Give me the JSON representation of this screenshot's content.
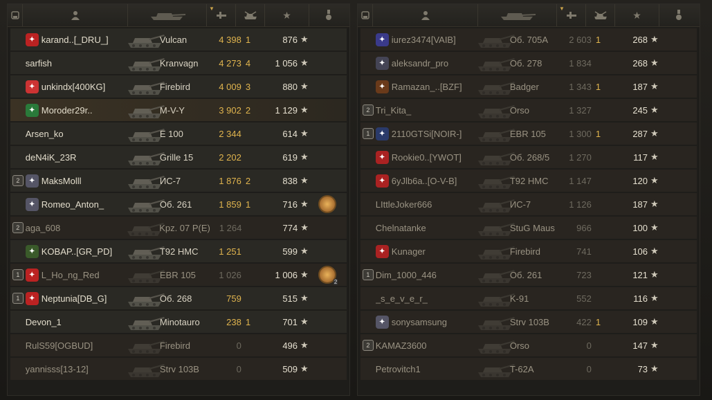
{
  "headers": {
    "platoon": "platoon",
    "player": "player",
    "tank": "tank",
    "damage": "damage",
    "kills": "kills",
    "xp": "xp",
    "achievements": "achievements"
  },
  "left_team": [
    {
      "name": "karand..[_DRU_]",
      "tank": "Vulcan",
      "damage": "4 398",
      "kills": "1",
      "xp": "876",
      "emblem": "#b22",
      "dead": false,
      "platoon": "",
      "medal": false
    },
    {
      "name": "sarfish",
      "tank": "Kranvagn",
      "damage": "4 273",
      "kills": "4",
      "xp": "1 056",
      "emblem": "",
      "dead": false,
      "platoon": "",
      "medal": false
    },
    {
      "name": "unkindx[400KG]",
      "tank": "Firebird",
      "damage": "4 009",
      "kills": "3",
      "xp": "880",
      "emblem": "#c33",
      "dead": false,
      "platoon": "",
      "medal": false
    },
    {
      "name": "Moroder29r..",
      "tank": "M-V-Y",
      "damage": "3 902",
      "kills": "2",
      "xp": "1 129",
      "emblem": "#2a7a3a",
      "dead": false,
      "platoon": "",
      "medal": false,
      "highlight": true
    },
    {
      "name": "Arsen_ko",
      "tank": "E 100",
      "damage": "2 344",
      "kills": "",
      "xp": "614",
      "emblem": "",
      "dead": false,
      "platoon": "",
      "medal": false
    },
    {
      "name": "deN4iK_23R",
      "tank": "Grille 15",
      "damage": "2 202",
      "kills": "",
      "xp": "619",
      "emblem": "",
      "dead": false,
      "platoon": "",
      "medal": false
    },
    {
      "name": "MaksMolll",
      "tank": "ИС-7",
      "damage": "1 876",
      "kills": "2",
      "xp": "838",
      "emblem": "#556",
      "dead": false,
      "platoon": "2",
      "medal": false
    },
    {
      "name": "Romeo_Anton_",
      "tank": "Об. 261",
      "damage": "1 859",
      "kills": "1",
      "xp": "716",
      "emblem": "#556",
      "dead": false,
      "platoon": "",
      "medal": true,
      "medal_count": ""
    },
    {
      "name": "aga_608",
      "tank": "Kpz. 07 P(E)",
      "damage": "1 264",
      "kills": "",
      "xp": "774",
      "emblem": "",
      "dead": true,
      "platoon": "2",
      "medal": false
    },
    {
      "name": "KOBAP..[GR_PD]",
      "tank": "T92 HMC",
      "damage": "1 251",
      "kills": "",
      "xp": "599",
      "emblem": "#3a5a2a",
      "dead": false,
      "platoon": "",
      "medal": false
    },
    {
      "name": "L_Ho_ng_Red",
      "tank": "EBR 105",
      "damage": "1 026",
      "kills": "",
      "xp": "1 006",
      "emblem": "#b22",
      "dead": true,
      "platoon": "1",
      "medal": true,
      "medal_count": "2"
    },
    {
      "name": "Neptunia[DB_G]",
      "tank": "Об. 268",
      "damage": "759",
      "kills": "",
      "xp": "515",
      "emblem": "#b22",
      "dead": false,
      "platoon": "1",
      "medal": false
    },
    {
      "name": "Devon_1",
      "tank": "Minotauro",
      "damage": "238",
      "kills": "1",
      "xp": "701",
      "emblem": "",
      "dead": false,
      "platoon": "",
      "medal": false
    },
    {
      "name": "RulS59[OGBUD]",
      "tank": "Firebird",
      "damage": "0",
      "kills": "",
      "xp": "496",
      "emblem": "",
      "dead": true,
      "platoon": "",
      "medal": false
    },
    {
      "name": "yannisss[13-12]",
      "tank": "Strv 103B",
      "damage": "0",
      "kills": "",
      "xp": "509",
      "emblem": "",
      "dead": true,
      "platoon": "",
      "medal": false
    }
  ],
  "right_team": [
    {
      "name": "iurez3474[VAIB]",
      "tank": "Об. 705А",
      "damage": "2 603",
      "kills": "1",
      "xp": "268",
      "emblem": "#3a3a8a",
      "dead": true,
      "platoon": "",
      "medal": false
    },
    {
      "name": "aleksandr_pro",
      "tank": "Об. 278",
      "damage": "1 834",
      "kills": "",
      "xp": "268",
      "emblem": "#445",
      "dead": true,
      "platoon": "",
      "medal": false
    },
    {
      "name": "Ramazan_..[BZF]",
      "tank": "Badger",
      "damage": "1 343",
      "kills": "1",
      "xp": "187",
      "emblem": "#6a3a1a",
      "dead": true,
      "platoon": "",
      "medal": false
    },
    {
      "name": "Tri_Kita_",
      "tank": "Orso",
      "damage": "1 327",
      "kills": "",
      "xp": "245",
      "emblem": "",
      "dead": true,
      "platoon": "2",
      "medal": false
    },
    {
      "name": "2110GTSi[NOIR-]",
      "tank": "EBR 105",
      "damage": "1 300",
      "kills": "1",
      "xp": "287",
      "emblem": "#2a3a6a",
      "dead": true,
      "platoon": "1",
      "medal": false
    },
    {
      "name": "Rookie0..[YWOT]",
      "tank": "Об. 268/5",
      "damage": "1 270",
      "kills": "",
      "xp": "117",
      "emblem": "#a22",
      "dead": true,
      "platoon": "",
      "medal": false
    },
    {
      "name": "6yJlb6a..[O-V-B]",
      "tank": "T92 HMC",
      "damage": "1 147",
      "kills": "",
      "xp": "120",
      "emblem": "#a22",
      "dead": true,
      "platoon": "",
      "medal": false
    },
    {
      "name": "LIttleJoker666",
      "tank": "ИС-7",
      "damage": "1 126",
      "kills": "",
      "xp": "187",
      "emblem": "",
      "dead": true,
      "platoon": "",
      "medal": false
    },
    {
      "name": "Chelnatanke",
      "tank": "StuG Maus",
      "damage": "966",
      "kills": "",
      "xp": "100",
      "emblem": "",
      "dead": true,
      "platoon": "",
      "medal": false
    },
    {
      "name": "Kunager",
      "tank": "Firebird",
      "damage": "741",
      "kills": "",
      "xp": "106",
      "emblem": "#a22",
      "dead": true,
      "platoon": "",
      "medal": false
    },
    {
      "name": "Dim_1000_446",
      "tank": "Об. 261",
      "damage": "723",
      "kills": "",
      "xp": "121",
      "emblem": "",
      "dead": true,
      "platoon": "1",
      "medal": false
    },
    {
      "name": "_s_e_v_e_r_",
      "tank": "K-91",
      "damage": "552",
      "kills": "",
      "xp": "116",
      "emblem": "",
      "dead": true,
      "platoon": "",
      "medal": false
    },
    {
      "name": "sonysamsung",
      "tank": "Strv 103B",
      "damage": "422",
      "kills": "1",
      "xp": "109",
      "emblem": "#556",
      "dead": true,
      "platoon": "",
      "medal": false
    },
    {
      "name": "KAMAZ3600",
      "tank": "Orso",
      "damage": "0",
      "kills": "",
      "xp": "147",
      "emblem": "",
      "dead": true,
      "platoon": "2",
      "medal": false
    },
    {
      "name": "Petrovitch1",
      "tank": "T-62A",
      "damage": "0",
      "kills": "",
      "xp": "73",
      "emblem": "",
      "dead": true,
      "platoon": "",
      "medal": false
    }
  ],
  "icons": {
    "star": "★",
    "platoon_header": "platoon-icon",
    "player_header": "player-icon",
    "tank_header": "tank-icon",
    "damage_header": "damage-icon",
    "kills_header": "kills-icon",
    "xp_header": "star-icon",
    "ach_header": "medal-icon"
  }
}
